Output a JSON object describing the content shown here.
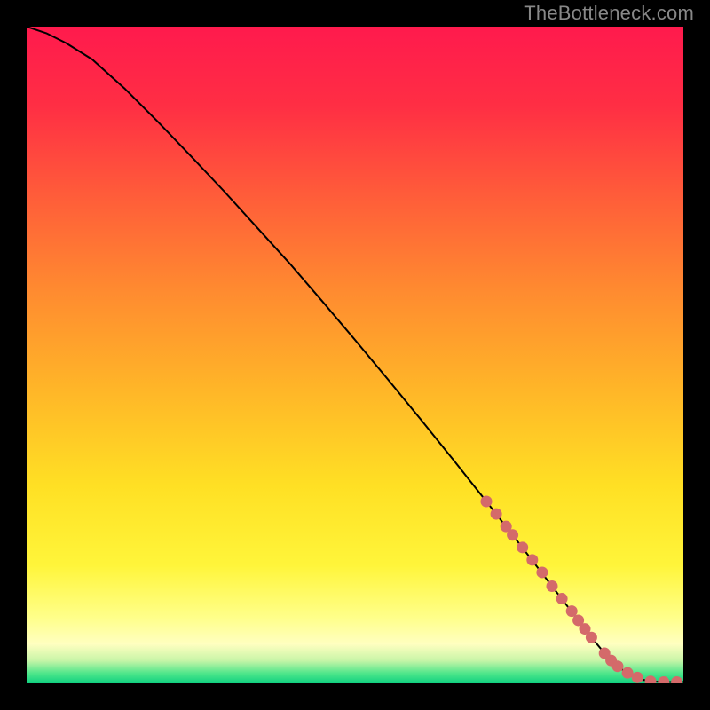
{
  "watermark": "TheBottleneck.com",
  "colors": {
    "curve": "#000000",
    "dot": "#d46a6a",
    "frame_bg": "#000000"
  },
  "chart_data": {
    "type": "line",
    "title": "",
    "xlabel": "",
    "ylabel": "",
    "xlim": [
      0,
      100
    ],
    "ylim": [
      0,
      100
    ],
    "background_gradient_stops": [
      {
        "pos": 0.0,
        "color": "#ff1a4d"
      },
      {
        "pos": 0.12,
        "color": "#ff2e44"
      },
      {
        "pos": 0.25,
        "color": "#ff5a3a"
      },
      {
        "pos": 0.4,
        "color": "#ff8a30"
      },
      {
        "pos": 0.55,
        "color": "#ffb528"
      },
      {
        "pos": 0.7,
        "color": "#ffe024"
      },
      {
        "pos": 0.82,
        "color": "#fff53a"
      },
      {
        "pos": 0.9,
        "color": "#ffff8a"
      },
      {
        "pos": 0.94,
        "color": "#ffffc0"
      },
      {
        "pos": 0.965,
        "color": "#c8f5a8"
      },
      {
        "pos": 0.985,
        "color": "#4de68a"
      },
      {
        "pos": 1.0,
        "color": "#10d080"
      }
    ],
    "series": [
      {
        "name": "bottleneck-curve",
        "x": [
          0,
          3,
          6,
          10,
          15,
          20,
          25,
          30,
          35,
          40,
          45,
          50,
          55,
          60,
          65,
          70,
          75,
          80,
          84,
          86,
          88,
          90,
          92,
          94,
          96,
          98,
          100
        ],
        "y": [
          100,
          99,
          97.5,
          95,
          90.5,
          85.5,
          80.3,
          75,
          69.5,
          64,
          58.2,
          52.3,
          46.3,
          40.2,
          34,
          27.7,
          21.3,
          14.8,
          9.6,
          7,
          4.6,
          2.6,
          1.2,
          0.5,
          0.25,
          0.2,
          0.2
        ]
      }
    ],
    "highlight_dots": {
      "name": "marker-dots",
      "x": [
        70,
        71.5,
        73,
        74,
        75.5,
        77,
        78.5,
        80,
        81.5,
        83,
        84,
        85,
        86,
        88,
        89,
        90,
        91.5,
        93,
        95,
        97,
        99
      ],
      "y": [
        27.7,
        25.8,
        23.9,
        22.6,
        20.7,
        18.8,
        16.9,
        14.8,
        12.9,
        11,
        9.6,
        8.3,
        7,
        4.6,
        3.5,
        2.6,
        1.6,
        0.9,
        0.3,
        0.2,
        0.2
      ]
    }
  }
}
